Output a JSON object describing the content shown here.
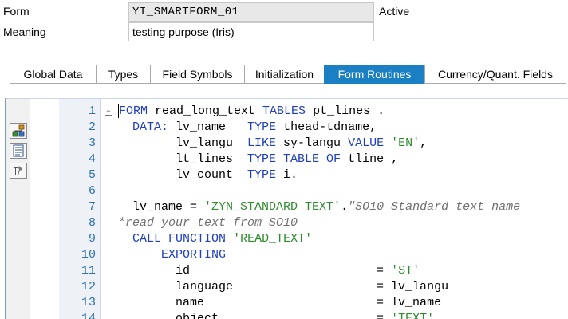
{
  "header": {
    "form_label": "Form",
    "form_name": "YI_SMARTFORM_01",
    "status": "Active",
    "meaning_label": "Meaning",
    "meaning_value": "testing purpose (Iris)"
  },
  "tabs": [
    {
      "label": "Global Data",
      "active": false
    },
    {
      "label": "Types",
      "active": false
    },
    {
      "label": "Field Symbols",
      "active": false
    },
    {
      "label": "Initialization",
      "active": false
    },
    {
      "label": "Form Routines",
      "active": true
    },
    {
      "label": "Currency/Quant. Fields",
      "active": false
    }
  ],
  "toolbar": [
    {
      "icon": "hierarchy-icon"
    },
    {
      "icon": "document-list-icon"
    },
    {
      "icon": "tools-icon"
    }
  ],
  "colors": {
    "active_tab": "#1b7fc4",
    "keyword": "#1f3fbf",
    "string": "#2e8b2e",
    "line_number": "#2f6fb3"
  },
  "code": {
    "lines": [
      {
        "n": "1",
        "fold": "−",
        "segments": [
          [
            "kw",
            "FORM"
          ],
          [
            "t",
            " read_long_text "
          ],
          [
            "kw",
            "TABLES"
          ],
          [
            "t",
            " pt_lines ."
          ]
        ]
      },
      {
        "n": "2",
        "segments": [
          [
            "t",
            "  "
          ],
          [
            "kw",
            "DATA:"
          ],
          [
            "t",
            " lv_name   "
          ],
          [
            "kw",
            "TYPE"
          ],
          [
            "t",
            " thead-tdname,"
          ]
        ]
      },
      {
        "n": "3",
        "segments": [
          [
            "t",
            "        lv_langu  "
          ],
          [
            "kw",
            "LIKE"
          ],
          [
            "t",
            " sy-langu "
          ],
          [
            "kw",
            "VALUE"
          ],
          [
            "t",
            " "
          ],
          [
            "str",
            "'EN'"
          ],
          [
            "t",
            ","
          ]
        ]
      },
      {
        "n": "4",
        "segments": [
          [
            "t",
            "        lt_lines  "
          ],
          [
            "kw",
            "TYPE TABLE OF"
          ],
          [
            "t",
            " tline ,"
          ]
        ]
      },
      {
        "n": "5",
        "segments": [
          [
            "t",
            "        lv_count  "
          ],
          [
            "kw",
            "TYPE"
          ],
          [
            "t",
            " i."
          ]
        ]
      },
      {
        "n": "6",
        "segments": []
      },
      {
        "n": "7",
        "segments": [
          [
            "t",
            "  lv_name = "
          ],
          [
            "str",
            "'ZYN_STANDARD TEXT'"
          ],
          [
            "t",
            "."
          ],
          [
            "cmt",
            "\"SO10 Standard text name"
          ]
        ]
      },
      {
        "n": "8",
        "segments": [
          [
            "cmt",
            "*read your text from SO10"
          ]
        ]
      },
      {
        "n": "9",
        "segments": [
          [
            "t",
            "  "
          ],
          [
            "kw",
            "CALL FUNCTION"
          ],
          [
            "t",
            " "
          ],
          [
            "str",
            "'READ_TEXT'"
          ]
        ]
      },
      {
        "n": "10",
        "segments": [
          [
            "t",
            "      "
          ],
          [
            "kw",
            "EXPORTING"
          ]
        ]
      },
      {
        "n": "11",
        "segments": [
          [
            "t",
            "        id                          = "
          ],
          [
            "str",
            "'ST'"
          ]
        ]
      },
      {
        "n": "12",
        "segments": [
          [
            "t",
            "        language                    = lv_langu"
          ]
        ]
      },
      {
        "n": "13",
        "segments": [
          [
            "t",
            "        name                        = lv_name"
          ]
        ]
      },
      {
        "n": "14",
        "segments": [
          [
            "t",
            "        object                      = "
          ],
          [
            "str",
            "'TEXT'"
          ]
        ]
      }
    ]
  }
}
